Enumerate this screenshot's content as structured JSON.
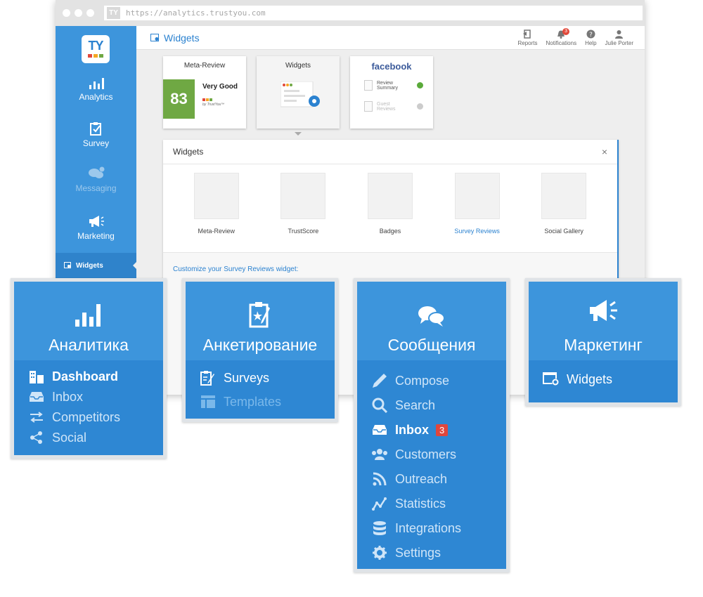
{
  "browser": {
    "url": "https://analytics.trustyou.com",
    "logo_text": "TY"
  },
  "sidebar": {
    "logo_text": "TY",
    "items": [
      {
        "label": "Analytics",
        "icon": "bar-chart-icon"
      },
      {
        "label": "Survey",
        "icon": "clipboard-icon"
      },
      {
        "label": "Messaging",
        "icon": "chat-bubbles-icon"
      },
      {
        "label": "Marketing",
        "icon": "megaphone-icon"
      }
    ],
    "sub_item": {
      "label": "Widgets",
      "icon": "widget-icon"
    }
  },
  "topbar": {
    "title": "Widgets",
    "actions": [
      {
        "label": "Reports",
        "icon": "report-icon"
      },
      {
        "label": "Notifications",
        "icon": "bell-icon",
        "badge": "3"
      },
      {
        "label": "Help",
        "icon": "help-icon"
      },
      {
        "label": "Julie Porter",
        "icon": "user-icon"
      }
    ]
  },
  "cards": {
    "meta_review": {
      "title": "Meta-Review",
      "score": "83",
      "rating": "Very Good",
      "byline": "by TrustYou™"
    },
    "widgets": {
      "title": "Widgets"
    },
    "facebook": {
      "title": "facebook",
      "row1": "Review Summary",
      "row2": "Guest Reviews"
    }
  },
  "panel": {
    "title": "Widgets",
    "close": "×",
    "types": [
      "Meta-Review",
      "TrustScore",
      "Badges",
      "Survey Reviews",
      "Social Gallery"
    ],
    "active_type": "Survey Reviews",
    "customize_label": "Customize your Survey Reviews widget:"
  },
  "overlays": {
    "analytics": {
      "title": "Аналитика",
      "items": [
        "Dashboard",
        "Inbox",
        "Competitors",
        "Social"
      ]
    },
    "survey": {
      "title": "Анкетирование",
      "items": [
        "Surveys",
        "Templates"
      ]
    },
    "messaging": {
      "title": "Сообщения",
      "items": [
        "Compose",
        "Search",
        "Inbox",
        "Customers",
        "Outreach",
        "Statistics",
        "Integrations",
        "Settings"
      ],
      "inbox_badge": "3"
    },
    "marketing": {
      "title": "Маркетинг",
      "items": [
        "Widgets"
      ]
    }
  },
  "colors": {
    "primary": "#3d95dc",
    "primary_dark": "#2e87d3",
    "score_green": "#6fa843",
    "badge_red": "#e0463c",
    "facebook_blue": "#3b5a9a"
  }
}
